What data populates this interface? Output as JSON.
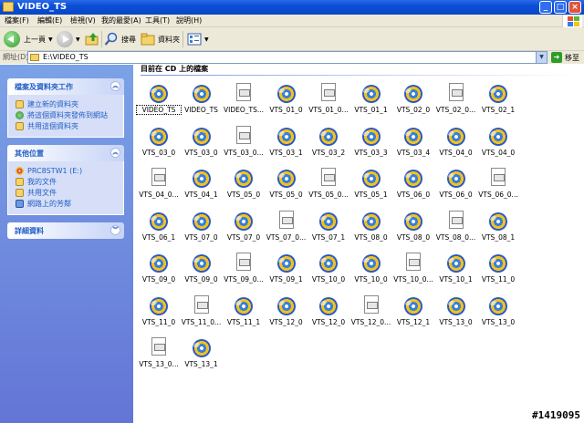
{
  "window": {
    "title": "VIDEO_TS"
  },
  "menu": [
    "檔案(F)",
    "編輯(E)",
    "檢視(V)",
    "我的最愛(A)",
    "工具(T)",
    "說明(H)"
  ],
  "toolbar": {
    "back": "上一頁",
    "search": "搜尋",
    "folders": "資料夾"
  },
  "address": {
    "label": "網址(D)",
    "value": "E:\\VIDEO_TS",
    "go": "移至"
  },
  "tasks_panel": {
    "title": "檔案及資料夾工作",
    "items": [
      "建立新的資料夾",
      "將這個資料夾發佈到網站",
      "共用這個資料夾"
    ]
  },
  "places_panel": {
    "title": "其他位置",
    "items": [
      "PRC8STW1 (E:)",
      "我的文件",
      "共用文件",
      "網路上的芳鄰"
    ]
  },
  "details_panel": {
    "title": "詳細資料"
  },
  "content": {
    "group_header": "目前在 CD 上的檔案"
  },
  "files": [
    {
      "name": "VIDEO_TS",
      "type": "dvd"
    },
    {
      "name": "VIDEO_TS",
      "type": "dvd"
    },
    {
      "name": "VIDEO_TS...",
      "type": "doc"
    },
    {
      "name": "VTS_01_0",
      "type": "dvd"
    },
    {
      "name": "VTS_01_0...",
      "type": "doc"
    },
    {
      "name": "VTS_01_1",
      "type": "dvd"
    },
    {
      "name": "VTS_02_0",
      "type": "dvd"
    },
    {
      "name": "VTS_02_0...",
      "type": "doc"
    },
    {
      "name": "VTS_02_1",
      "type": "dvd"
    },
    {
      "name": "VTS_03_0",
      "type": "dvd"
    },
    {
      "name": "VTS_03_0",
      "type": "dvd"
    },
    {
      "name": "VTS_03_0...",
      "type": "doc"
    },
    {
      "name": "VTS_03_1",
      "type": "dvd"
    },
    {
      "name": "VTS_03_2",
      "type": "dvd"
    },
    {
      "name": "VTS_03_3",
      "type": "dvd"
    },
    {
      "name": "VTS_03_4",
      "type": "dvd"
    },
    {
      "name": "VTS_04_0",
      "type": "dvd"
    },
    {
      "name": "VTS_04_0",
      "type": "dvd"
    },
    {
      "name": "VTS_04_0...",
      "type": "doc"
    },
    {
      "name": "VTS_04_1",
      "type": "dvd"
    },
    {
      "name": "VTS_05_0",
      "type": "dvd"
    },
    {
      "name": "VTS_05_0",
      "type": "dvd"
    },
    {
      "name": "VTS_05_0...",
      "type": "doc"
    },
    {
      "name": "VTS_05_1",
      "type": "dvd"
    },
    {
      "name": "VTS_06_0",
      "type": "dvd"
    },
    {
      "name": "VTS_06_0",
      "type": "dvd"
    },
    {
      "name": "VTS_06_0...",
      "type": "doc"
    },
    {
      "name": "VTS_06_1",
      "type": "dvd"
    },
    {
      "name": "VTS_07_0",
      "type": "dvd"
    },
    {
      "name": "VTS_07_0",
      "type": "dvd"
    },
    {
      "name": "VTS_07_0...",
      "type": "doc"
    },
    {
      "name": "VTS_07_1",
      "type": "dvd"
    },
    {
      "name": "VTS_08_0",
      "type": "dvd"
    },
    {
      "name": "VTS_08_0",
      "type": "dvd"
    },
    {
      "name": "VTS_08_0...",
      "type": "doc"
    },
    {
      "name": "VTS_08_1",
      "type": "dvd"
    },
    {
      "name": "VTS_09_0",
      "type": "dvd"
    },
    {
      "name": "VTS_09_0",
      "type": "dvd"
    },
    {
      "name": "VTS_09_0...",
      "type": "doc"
    },
    {
      "name": "VTS_09_1",
      "type": "dvd"
    },
    {
      "name": "VTS_10_0",
      "type": "dvd"
    },
    {
      "name": "VTS_10_0",
      "type": "dvd"
    },
    {
      "name": "VTS_10_0...",
      "type": "doc"
    },
    {
      "name": "VTS_10_1",
      "type": "dvd"
    },
    {
      "name": "VTS_11_0",
      "type": "dvd"
    },
    {
      "name": "VTS_11_0",
      "type": "dvd"
    },
    {
      "name": "VTS_11_0...",
      "type": "doc"
    },
    {
      "name": "VTS_11_1",
      "type": "dvd"
    },
    {
      "name": "VTS_12_0",
      "type": "dvd"
    },
    {
      "name": "VTS_12_0",
      "type": "dvd"
    },
    {
      "name": "VTS_12_0...",
      "type": "doc"
    },
    {
      "name": "VTS_12_1",
      "type": "dvd"
    },
    {
      "name": "VTS_13_0",
      "type": "dvd"
    },
    {
      "name": "VTS_13_0",
      "type": "dvd"
    },
    {
      "name": "VTS_13_0...",
      "type": "doc"
    },
    {
      "name": "VTS_13_1",
      "type": "dvd"
    }
  ],
  "watermark": "#1419095"
}
